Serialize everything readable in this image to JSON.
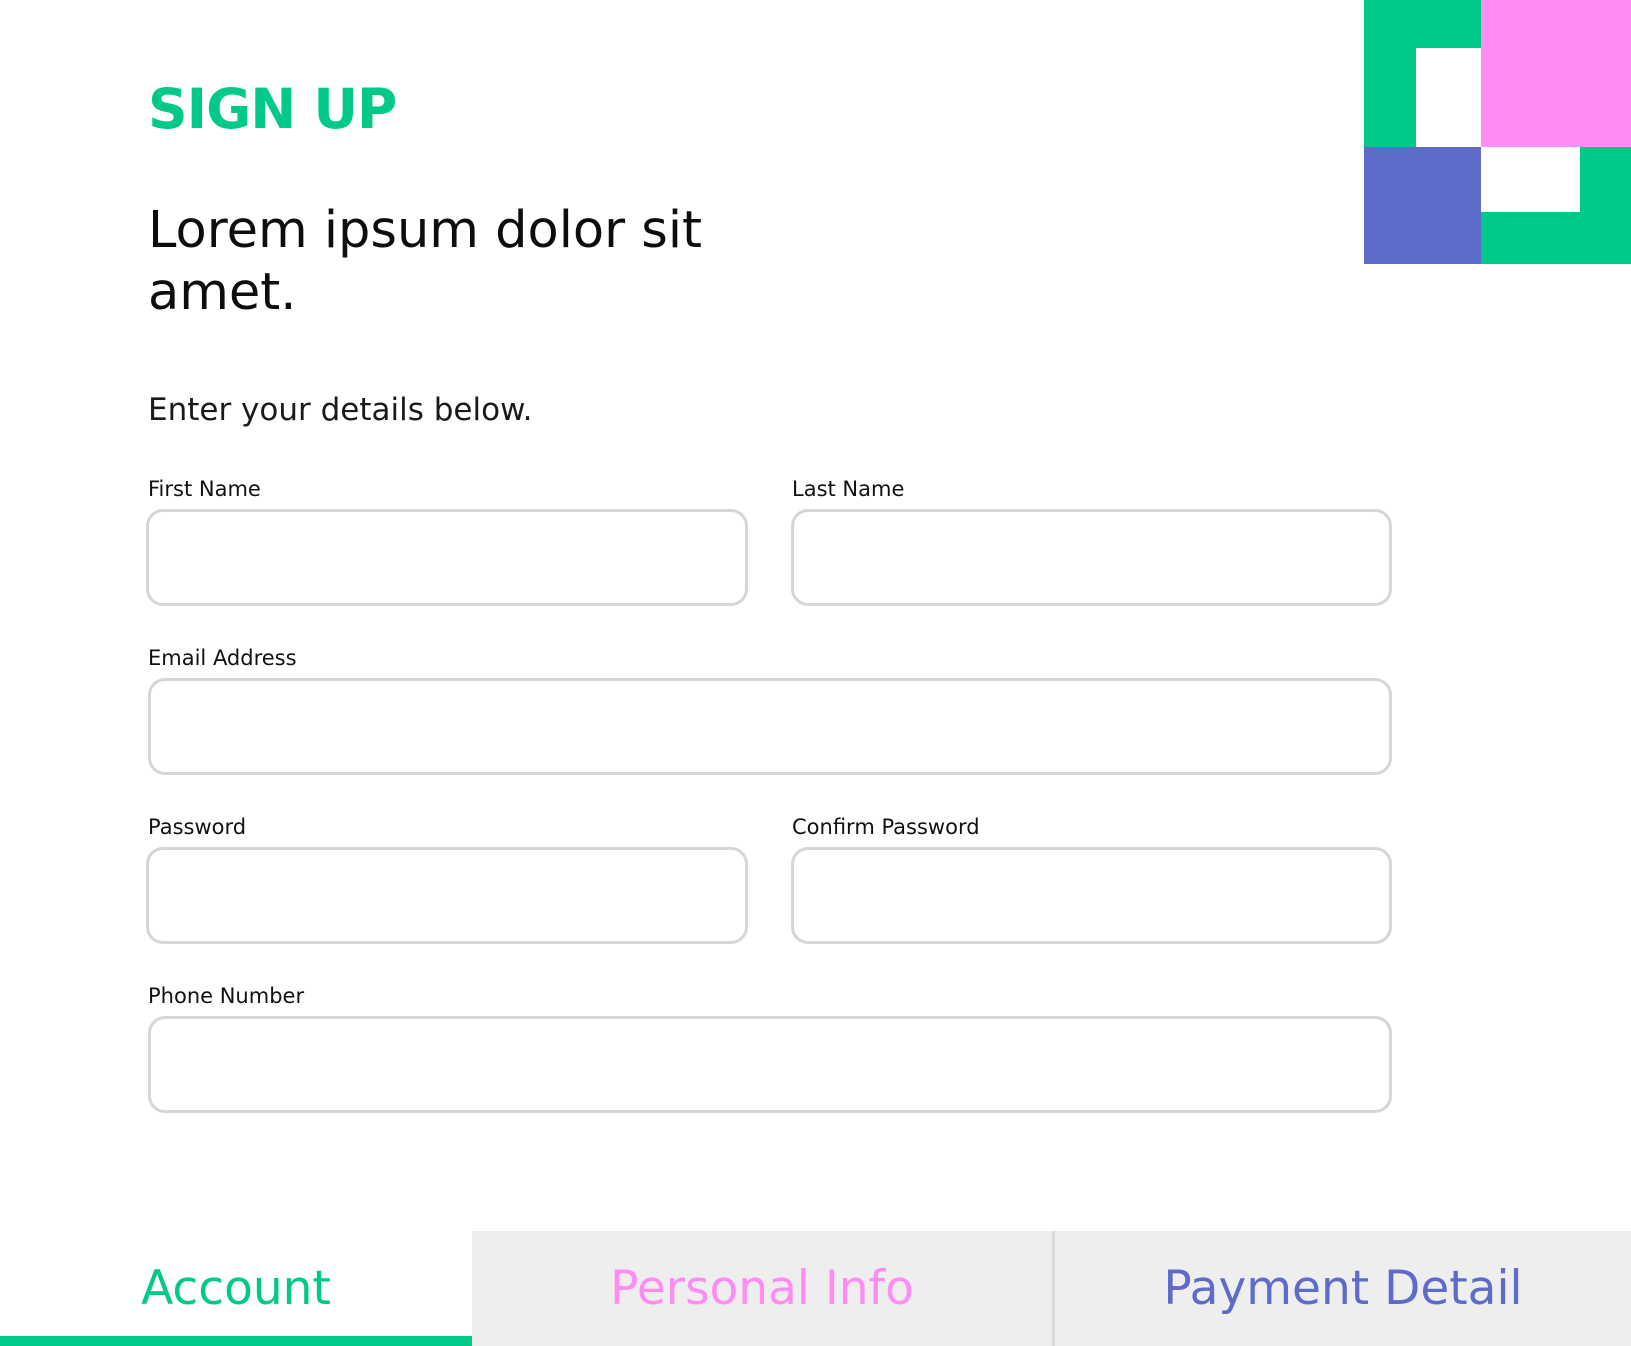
{
  "header": {
    "title": "SIGN UP",
    "headline": "Lorem ipsum dolor sit amet.",
    "intro": "Enter your details below."
  },
  "form": {
    "first_name": {
      "label": "First Name",
      "value": ""
    },
    "last_name": {
      "label": "Last Name",
      "value": ""
    },
    "email": {
      "label": "Email Address",
      "value": ""
    },
    "password": {
      "label": "Password",
      "value": ""
    },
    "confirm_password": {
      "label": "Confirm Password",
      "value": ""
    },
    "phone": {
      "label": "Phone Number",
      "value": ""
    }
  },
  "tabs": [
    {
      "label": "Account",
      "active": true,
      "color": "#00c98a"
    },
    {
      "label": "Personal Info",
      "active": false,
      "color": "#ff8cf2"
    },
    {
      "label": "Payment Detail",
      "active": false,
      "color": "#5f6bc9"
    }
  ],
  "colors": {
    "accent_green": "#00c98a",
    "accent_pink": "#ff8cf2",
    "accent_purple": "#5f6bc9",
    "input_border": "#d6d6d6",
    "tab_background": "#eeeeee"
  }
}
